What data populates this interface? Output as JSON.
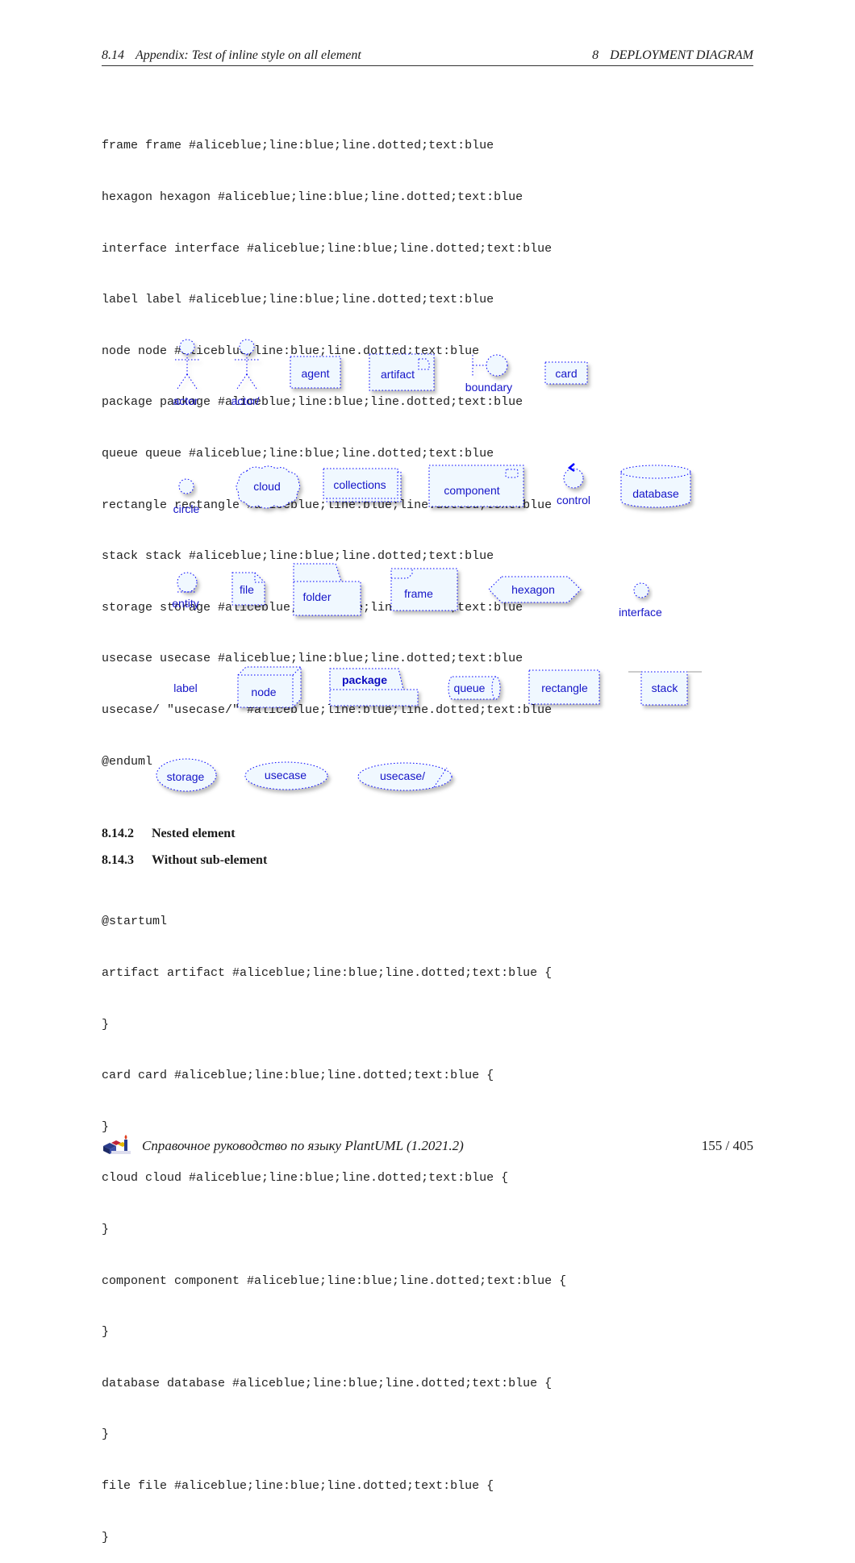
{
  "header": {
    "section_number": "8.14",
    "section_title": "Appendix: Test of inline style on all element",
    "chapter_number": "8",
    "chapter_title": "DEPLOYMENT DIAGRAM"
  },
  "code_block_1": [
    "frame frame #aliceblue;line:blue;line.dotted;text:blue",
    "hexagon hexagon #aliceblue;line:blue;line.dotted;text:blue",
    "interface interface #aliceblue;line:blue;line.dotted;text:blue",
    "label label #aliceblue;line:blue;line.dotted;text:blue",
    "node node #aliceblue;line:blue;line.dotted;text:blue",
    "package package #aliceblue;line:blue;line.dotted;text:blue",
    "queue queue #aliceblue;line:blue;line.dotted;text:blue",
    "rectangle rectangle #aliceblue;line:blue;line.dotted;text:blue",
    "stack stack #aliceblue;line:blue;line.dotted;text:blue",
    "storage storage #aliceblue;line:blue;line.dotted;text:blue",
    "usecase usecase #aliceblue;line:blue;line.dotted;text:blue",
    "usecase/ \"usecase/\" #aliceblue;line:blue;line.dotted;text:blue",
    "@enduml"
  ],
  "diagram": {
    "fill_color": "#f0f8ff",
    "line_color": "#0000ff",
    "text_color": "#1515c8",
    "elements": {
      "actor": "actor",
      "actor_slash": "actor/",
      "agent": "agent",
      "artifact": "artifact",
      "boundary": "boundary",
      "card": "card",
      "circle": "circle",
      "cloud": "cloud",
      "collections": "collections",
      "component": "component",
      "control": "control",
      "database": "database",
      "entity": "entity",
      "file": "file",
      "folder": "folder",
      "frame": "frame",
      "hexagon": "hexagon",
      "interface": "interface",
      "label": "label",
      "node": "node",
      "package": "package",
      "queue": "queue",
      "rectangle": "rectangle",
      "stack": "stack",
      "storage": "storage",
      "usecase": "usecase",
      "usecase_slash": "usecase/"
    }
  },
  "sections": [
    {
      "number": "8.14.2",
      "title": "Nested element"
    },
    {
      "number": "8.14.3",
      "title": "Without sub-element"
    }
  ],
  "code_block_2": [
    "@startuml",
    "artifact artifact #aliceblue;line:blue;line.dotted;text:blue {",
    "}",
    "card card #aliceblue;line:blue;line.dotted;text:blue {",
    "}",
    "cloud cloud #aliceblue;line:blue;line.dotted;text:blue {",
    "}",
    "component component #aliceblue;line:blue;line.dotted;text:blue {",
    "}",
    "database database #aliceblue;line:blue;line.dotted;text:blue {",
    "}",
    "file file #aliceblue;line:blue;line.dotted;text:blue {",
    "}"
  ],
  "footer": {
    "logo": "plantuml-logo-icon",
    "title": "Справочное руководство по языку PlantUML (1.2021.2)",
    "page": "155 / 405"
  }
}
